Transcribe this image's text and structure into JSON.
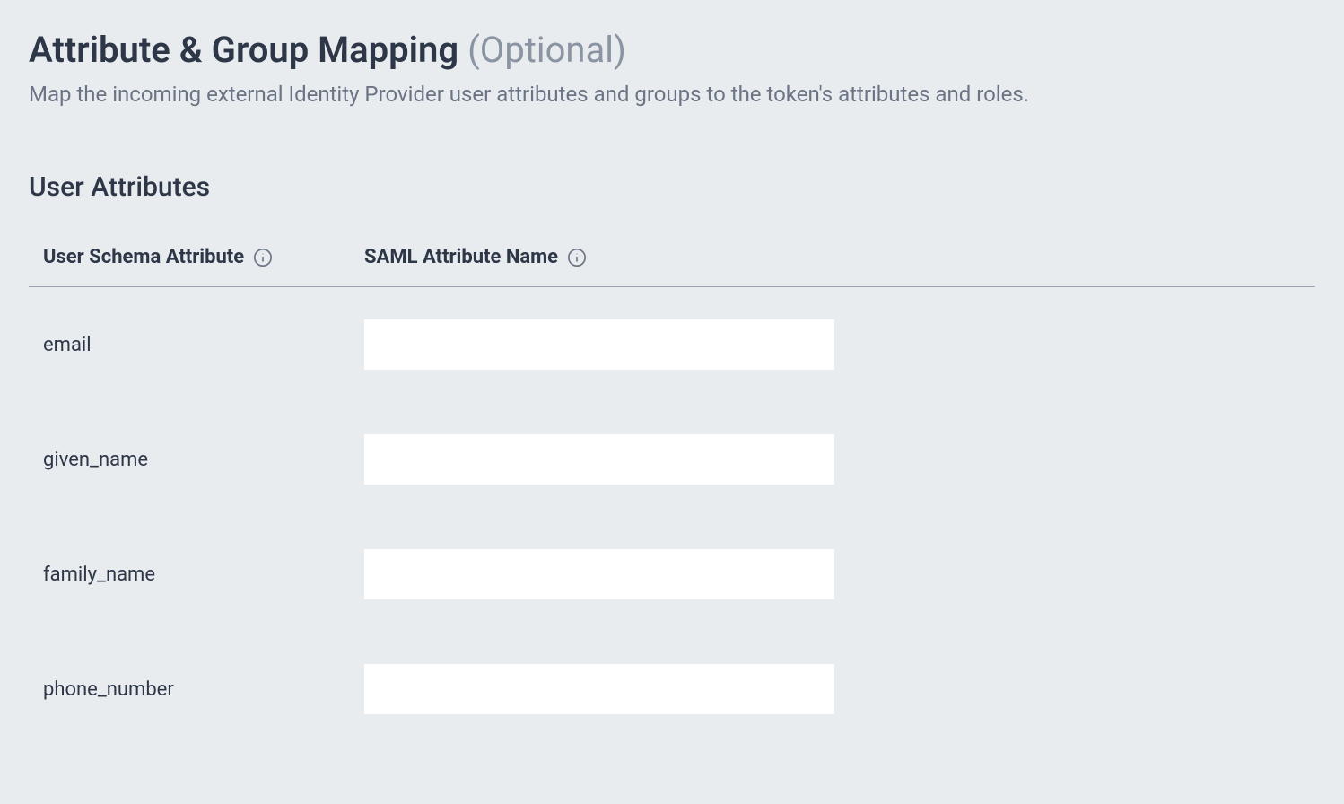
{
  "header": {
    "title": "Attribute & Group Mapping",
    "optional_suffix": "(Optional)",
    "subtitle": "Map the incoming external Identity Provider user attributes and groups to the token's attributes and roles."
  },
  "section": {
    "title": "User Attributes",
    "columns": {
      "schema": "User Schema Attribute",
      "saml": "SAML Attribute Name"
    }
  },
  "rows": [
    {
      "schema": "email",
      "saml": ""
    },
    {
      "schema": "given_name",
      "saml": ""
    },
    {
      "schema": "family_name",
      "saml": ""
    },
    {
      "schema": "phone_number",
      "saml": ""
    }
  ]
}
